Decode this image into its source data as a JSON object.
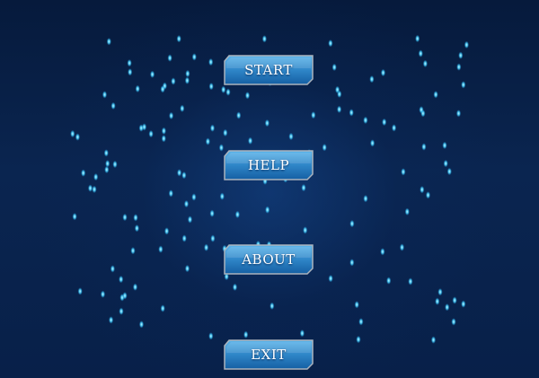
{
  "theme": {
    "background": "#071a3f",
    "streak_color": "#1aa3e8",
    "drop_color": "#6fe3ff",
    "button_fill_top": "#4aa6e0",
    "button_fill_bottom": "#1565a8",
    "button_border": "#9aa4b0",
    "button_text": "#ffffff"
  },
  "menu": {
    "buttons": [
      {
        "id": "start",
        "label": "START"
      },
      {
        "id": "help",
        "label": "HELP"
      },
      {
        "id": "about",
        "label": "ABOUT"
      },
      {
        "id": "exit",
        "label": "EXIT"
      }
    ]
  }
}
